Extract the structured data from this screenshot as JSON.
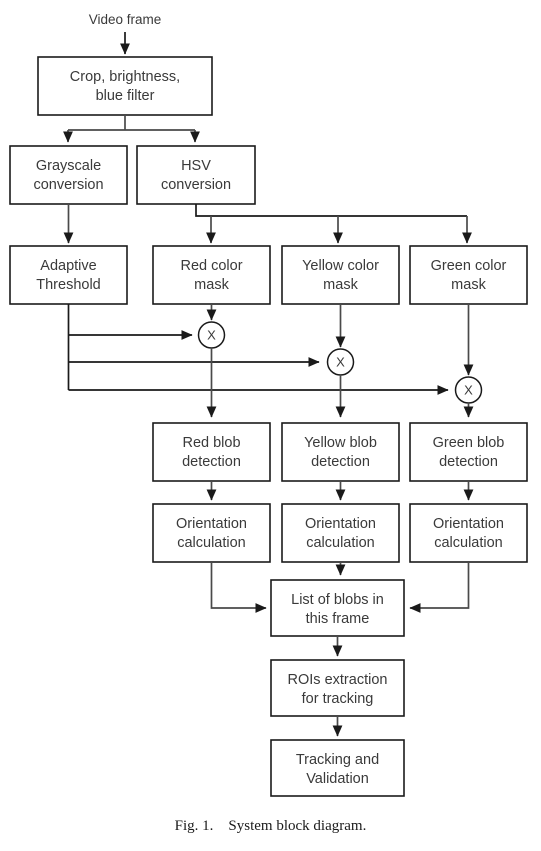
{
  "figure": {
    "input_label": "Video frame",
    "caption_prefix": "Fig. 1.",
    "caption_text": "System block diagram.",
    "caption_full": "Fig. 1.    System block diagram.",
    "colors": {
      "box_stroke": "#1a1a1a",
      "edge": "#4a4a4a",
      "text": "#3a3a3a",
      "background": "#ffffff"
    }
  },
  "boxes": {
    "preprocess": {
      "line1": "Crop, brightness,",
      "line2": "blue filter"
    },
    "grayscale": {
      "line1": "Grayscale",
      "line2": "conversion"
    },
    "hsv": {
      "line1": "HSV",
      "line2": "conversion"
    },
    "adaptive_threshold": {
      "line1": "Adaptive",
      "line2": "Threshold"
    },
    "red_mask": {
      "line1": "Red color",
      "line2": "mask"
    },
    "yellow_mask": {
      "line1": "Yellow color",
      "line2": "mask"
    },
    "green_mask": {
      "line1": "Green color",
      "line2": "mask"
    },
    "red_blob": {
      "line1": "Red blob",
      "line2": "detection"
    },
    "yellow_blob": {
      "line1": "Yellow blob",
      "line2": "detection"
    },
    "green_blob": {
      "line1": "Green  blob",
      "line2": "detection"
    },
    "orientation_red": {
      "line1": "Orientation",
      "line2": "calculation"
    },
    "orientation_yellow": {
      "line1": "Orientation",
      "line2": "calculation"
    },
    "orientation_green": {
      "line1": "Orientation",
      "line2": "calculation"
    },
    "blob_list": {
      "line1": "List of blobs in",
      "line2": "this frame"
    },
    "roi": {
      "line1": "ROIs extraction",
      "line2": "for tracking"
    },
    "tracking": {
      "line1": "Tracking and",
      "line2": "Validation"
    }
  },
  "operators": {
    "multiply_red": {
      "symbol": "X"
    },
    "multiply_yellow": {
      "symbol": "X"
    },
    "multiply_green": {
      "symbol": "X"
    }
  }
}
